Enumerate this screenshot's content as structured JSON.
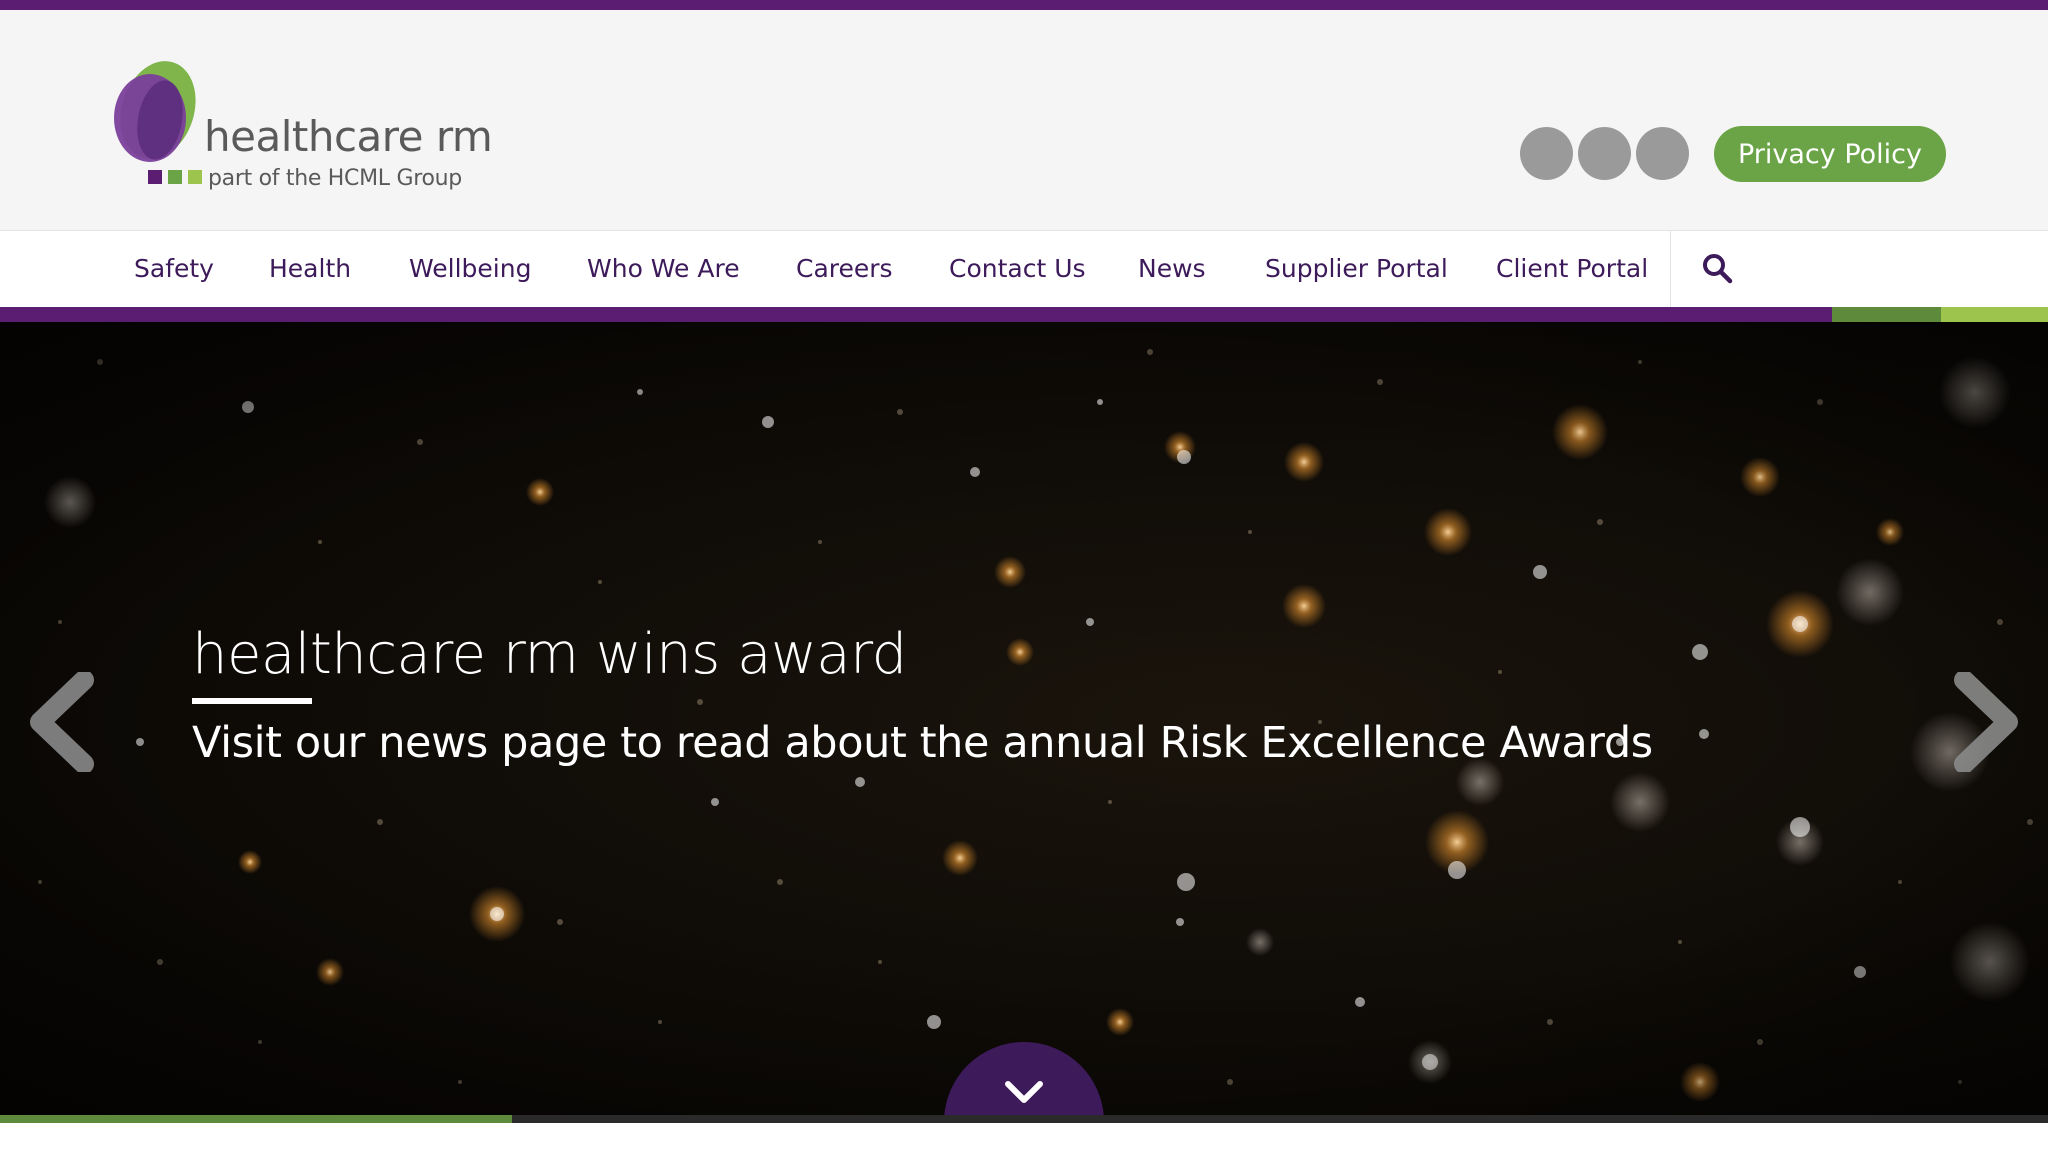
{
  "header": {
    "logo": {
      "name": "healthcare rm",
      "tagline": "part of the HCML Group"
    },
    "social_icons": [
      "social-icon",
      "social-icon",
      "social-icon"
    ],
    "privacy_button": "Privacy Policy"
  },
  "nav": {
    "items": [
      {
        "label": "Safety"
      },
      {
        "label": "Health"
      },
      {
        "label": "Wellbeing"
      },
      {
        "label": "Who We Are"
      },
      {
        "label": "Careers"
      },
      {
        "label": "Contact Us"
      },
      {
        "label": "News"
      },
      {
        "label": "Supplier Portal"
      },
      {
        "label": "Client Portal"
      }
    ],
    "search_icon": "search-icon"
  },
  "hero": {
    "title": "healthcare rm wins award",
    "subtitle": "Visit our news page to read about the annual Risk Excellence Awards",
    "prev_icon": "chevron-left-icon",
    "next_icon": "chevron-right-icon",
    "scroll_icon": "chevron-down-icon",
    "slide_progress": 0.25
  },
  "colors": {
    "brand_purple": "#5a1d72",
    "nav_text": "#3d1a5a",
    "brand_green": "#6aa446",
    "accent_green_dark": "#5e8a3c",
    "accent_green_light": "#9dc44d"
  }
}
